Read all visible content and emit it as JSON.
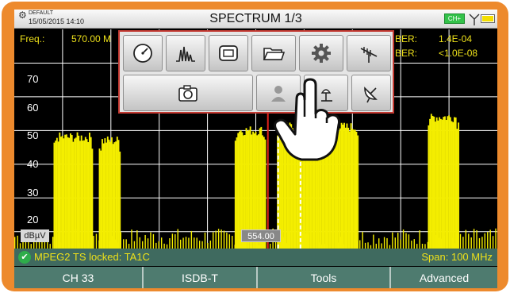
{
  "header": {
    "profile": "DEFAULT",
    "datetime": "15/05/2015 14:10",
    "title": "SPECTRUM 1/3",
    "ch_badge": "CH+"
  },
  "info": {
    "freq_label": "Freq.:",
    "freq_value": "570.00 M",
    "ber1_label": "BER:",
    "ber1_value": "1.4E-04",
    "ber2_label": "BER:",
    "ber2_value": "<1.0E-08"
  },
  "axis": {
    "unit": "dBµV",
    "y_labels": [
      "70",
      "60",
      "50",
      "40",
      "30",
      "20"
    ],
    "marker_freq": "554.00"
  },
  "chart_data": {
    "type": "area",
    "ylabel": "dBµV",
    "ylim": [
      15,
      80
    ],
    "x_unit": "MHz",
    "marker_x": 554.0,
    "selected_x": 570.0,
    "channels": [
      {
        "from": 483.0,
        "to": 496.0,
        "level_dbuv": 48
      },
      {
        "from": 498.0,
        "to": 505.0,
        "level_dbuv": 47
      },
      {
        "from": 543.0,
        "to": 553.0,
        "level_dbuv": 50
      },
      {
        "from": 557.0,
        "to": 584.0,
        "level_dbuv": 51
      },
      {
        "from": 607.0,
        "to": 617.0,
        "level_dbuv": 54
      }
    ],
    "noise_floor_dbuv": 16
  },
  "toolbar": {
    "row1": [
      "measure-gauge",
      "spectrum-analyzer",
      "screen-display",
      "file-folder",
      "settings-gear",
      "antenna"
    ],
    "row2": [
      "screenshot-camera",
      "user-profile",
      "brightness-lamp",
      "satellite-dish"
    ]
  },
  "status": {
    "lock_text": "MPEG2 TS locked: TA1C",
    "span_text": "Span: 100 MHz"
  },
  "softkeys": [
    "CH 33",
    "ISDB-T",
    "Tools",
    "Advanced"
  ],
  "colors": {
    "frame": "#ed8a2d",
    "spectrum": "#f4ee00",
    "marker": "#e3221b",
    "status_bar": "#3f6a5f",
    "softkey_bar": "#4e7b6f",
    "popup_border": "#c43a32"
  }
}
